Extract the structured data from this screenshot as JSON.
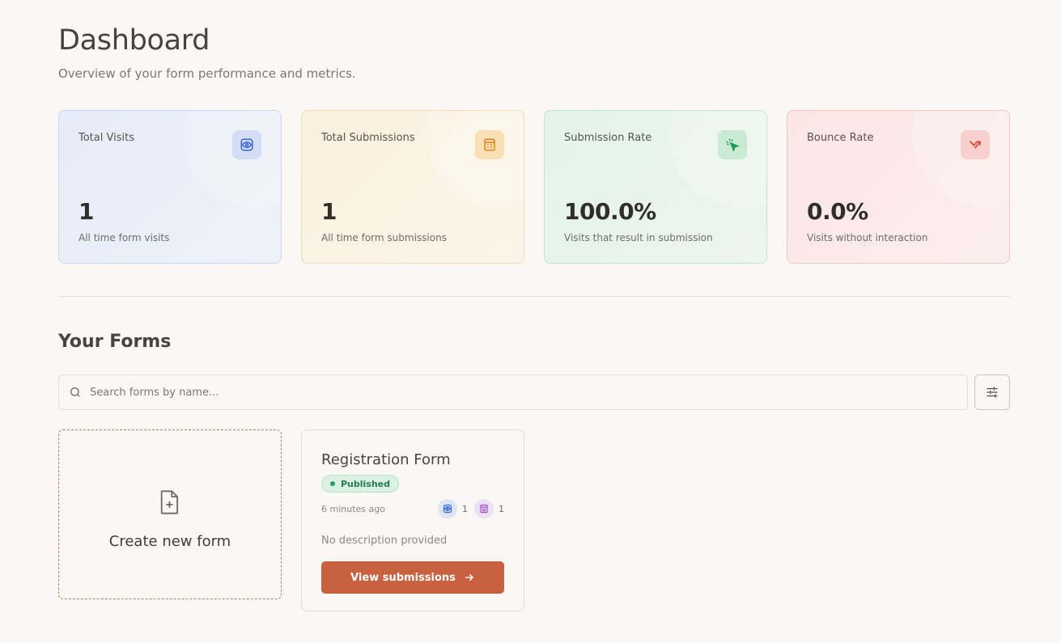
{
  "header": {
    "title": "Dashboard",
    "subtitle": "Overview of your form performance and metrics."
  },
  "stats": [
    {
      "label": "Total Visits",
      "value": "1",
      "description": "All time form visits",
      "icon": "eye-icon",
      "color": "#3567d6"
    },
    {
      "label": "Total Submissions",
      "value": "1",
      "description": "All time form submissions",
      "icon": "form-icon",
      "color": "#d9861c"
    },
    {
      "label": "Submission Rate",
      "value": "100.0%",
      "description": "Visits that result in submission",
      "icon": "cursor-click-icon",
      "color": "#1f9a4f"
    },
    {
      "label": "Bounce Rate",
      "value": "0.0%",
      "description": "Visits without interaction",
      "icon": "arrow-bounce-icon",
      "color": "#d9413b"
    }
  ],
  "forms_section": {
    "title": "Your Forms",
    "search_placeholder": "Search forms by name...",
    "filter_icon": "sliders-icon",
    "create_label": "Create new form",
    "create_icon": "file-plus-icon",
    "forms": [
      {
        "name": "Registration Form",
        "status": "Published",
        "updated": "6 minutes ago",
        "visits": "1",
        "submissions": "1",
        "description": "No description provided",
        "action_label": "View submissions"
      }
    ]
  },
  "colors": {
    "background": "#faf8f4",
    "accent": "#c7613f",
    "published": "#237d4a"
  }
}
